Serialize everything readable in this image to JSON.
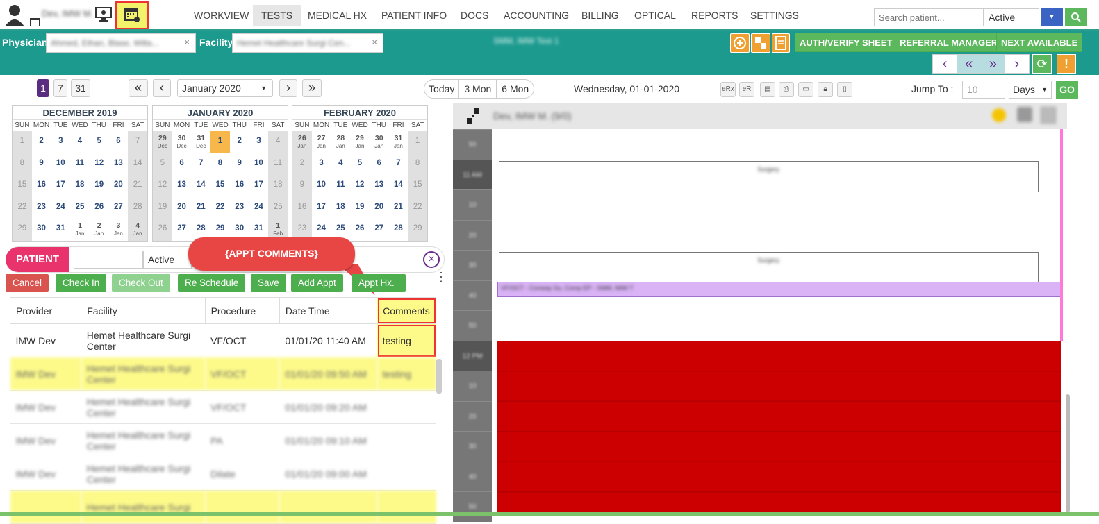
{
  "topnav": {
    "user_name": "Dev, IMW M.",
    "tabs": [
      "WORKVIEW",
      "TESTS",
      "MEDICAL HX",
      "PATIENT INFO",
      "DOCS",
      "ACCOUNTING",
      "BILLING",
      "OPTICAL",
      "REPORTS",
      "SETTINGS"
    ],
    "search_placeholder": "Search patient...",
    "status_value": "Active"
  },
  "tealbar": {
    "physician_label": "Physician",
    "physician_value": "Ahmed, Ethan, Blase, Willa...",
    "facility_label": "Facility",
    "facility_value": "Hemet Healthcare Surgi Cen...",
    "center_text": "SMM, IMW Test 1",
    "btn_auth": "AUTH/VERIFY SHEET",
    "btn_referral": "REFERRAL MANAGER",
    "btn_next": "NEXT AVAILABLE"
  },
  "toolbar": {
    "view_1": "1",
    "view_7": "7",
    "view_31": "31",
    "month_select": "January 2020",
    "today": "Today",
    "three_mon": "3 Mon",
    "six_mon": "6 Mon",
    "date_label": "Wednesday, 01-01-2020",
    "erx": "eRx",
    "er": "eR",
    "jump_label": "Jump To :",
    "jump_value": "10",
    "jump_unit": "Days",
    "go": "GO"
  },
  "calendars": {
    "dec_title": "DECEMBER 2019",
    "jan_title": "JANUARY 2020",
    "feb_title": "FEBRUARY 2020",
    "dow": [
      "SUN",
      "MON",
      "TUE",
      "WED",
      "THU",
      "FRI",
      "SAT"
    ]
  },
  "patient": {
    "label": "PATIENT",
    "status": "Active",
    "callout": "{APPT COMMENTS}"
  },
  "actions": {
    "cancel": "Cancel",
    "check_in": "Check In",
    "check_out": "Check Out",
    "reschedule": "Re Schedule",
    "save": "Save",
    "add_appt": "Add Appt",
    "appt_hx": "Appt Hx."
  },
  "table": {
    "headers": [
      "Provider",
      "Facility",
      "Procedure",
      "Date Time",
      "Comments"
    ],
    "rows": [
      [
        "IMW Dev",
        "Hemet Healthcare Surgi Center",
        "VF/OCT",
        "01/01/20 11:40 AM",
        "testing"
      ],
      [
        "IMW Dev",
        "Hemet Healthcare Surgi Center",
        "VF/OCT",
        "01/01/20 09:50 AM",
        "testing"
      ],
      [
        "IMW Dev",
        "Hemet Healthcare Surgi Center",
        "VF/OCT",
        "01/01/20 09:20 AM",
        ""
      ],
      [
        "IMW Dev",
        "Hemet Healthcare Surgi Center",
        "PA",
        "01/01/20 09:10 AM",
        ""
      ],
      [
        "IMW Dev",
        "Hemet Healthcare Surgi Center",
        "Dilate",
        "01/01/20 09:00 AM",
        ""
      ],
      [
        "",
        "Hemet Healthcare Surgi",
        "",
        "",
        ""
      ]
    ]
  },
  "schedule": {
    "provider_header": "Dev, IMW M. (9/0)",
    "slots": [
      "50",
      "11 AM",
      "10",
      "20",
      "30",
      "40",
      "50",
      "12 PM",
      "10",
      "20",
      "30",
      "40",
      "50"
    ],
    "block1": "Surgery",
    "block2": "Surgery",
    "appt": "VF/OCT - Conway Su, Comp EP - SMM, IMW T"
  },
  "colors": {
    "teal": "#1c9a8e",
    "green": "#5cb85c",
    "red": "#cc0000",
    "purple_appt": "#d9b3f5",
    "highlight": "#fdfa8a",
    "patient_pink": "#e8336d"
  }
}
